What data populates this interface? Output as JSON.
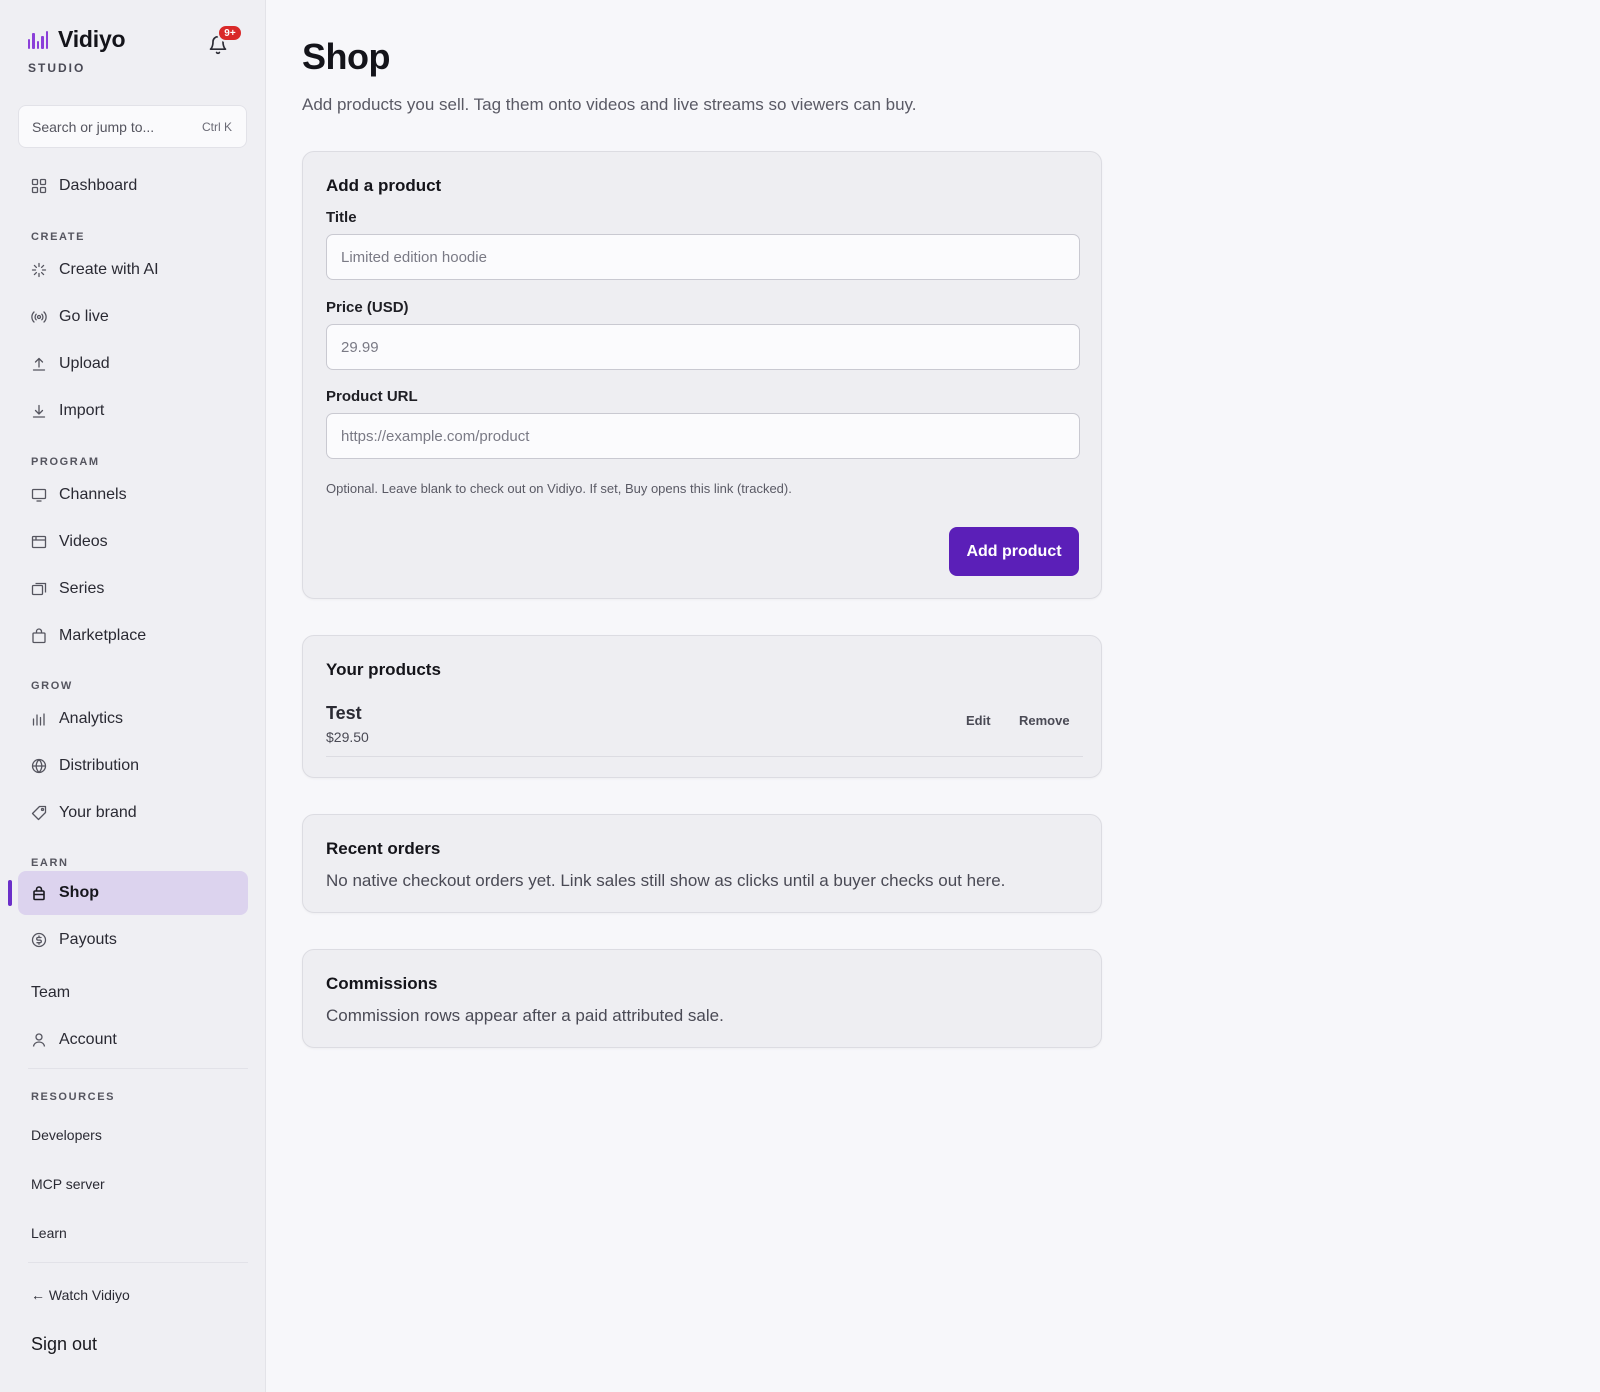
{
  "brand": {
    "name": "Vidiyo",
    "subtitle": "STUDIO",
    "logo_color": "#8b3fd9"
  },
  "notifications": {
    "icon": "bell-icon",
    "badge": "9+"
  },
  "search": {
    "placeholder": "Search or jump to...",
    "shortcut": "Ctrl K"
  },
  "sidebar": {
    "dashboard": "Dashboard",
    "sections": {
      "create": "CREATE",
      "program": "PROGRAM",
      "grow": "GROW",
      "earn": "EARN",
      "resources": "RESOURCES"
    },
    "items": {
      "create_ai": "Create with AI",
      "go_live": "Go live",
      "upload": "Upload",
      "import": "Import",
      "channels": "Channels",
      "videos": "Videos",
      "series": "Series",
      "marketplace": "Marketplace",
      "analytics": "Analytics",
      "distribution": "Distribution",
      "your_brand": "Your brand",
      "shop": "Shop",
      "payouts": "Payouts",
      "team": "Team",
      "account": "Account",
      "developers": "Developers",
      "mcp_server": "MCP server",
      "learn": "Learn",
      "watch": "← Watch Vidiyo",
      "sign_out": "Sign out"
    },
    "active": "shop",
    "accent_color": "#6b2fc9"
  },
  "page": {
    "title": "Shop",
    "subtitle": "Add products you sell. Tag them onto videos and live streams so viewers can buy."
  },
  "add_product": {
    "heading": "Add a product",
    "title_label": "Title",
    "title_placeholder": "Limited edition hoodie",
    "title_value": "",
    "price_label": "Price (USD)",
    "price_placeholder": "29.99",
    "price_value": "",
    "url_label": "Product URL",
    "url_placeholder": "https://example.com/product",
    "url_value": "",
    "url_hint": "Optional. Leave blank to check out on Vidiyo. If set, Buy opens this link (tracked).",
    "submit_label": "Add product",
    "submit_color": "#5b1fb8"
  },
  "products": {
    "heading": "Your products",
    "items": [
      {
        "name": "Test",
        "price": "$29.50",
        "edit_label": "Edit",
        "remove_label": "Remove"
      }
    ]
  },
  "orders": {
    "heading": "Recent orders",
    "empty_text": "No native checkout orders yet. Link sales still show as clicks until a buyer checks out here."
  },
  "commissions": {
    "heading": "Commissions",
    "empty_text": "Commission rows appear after a paid attributed sale."
  }
}
